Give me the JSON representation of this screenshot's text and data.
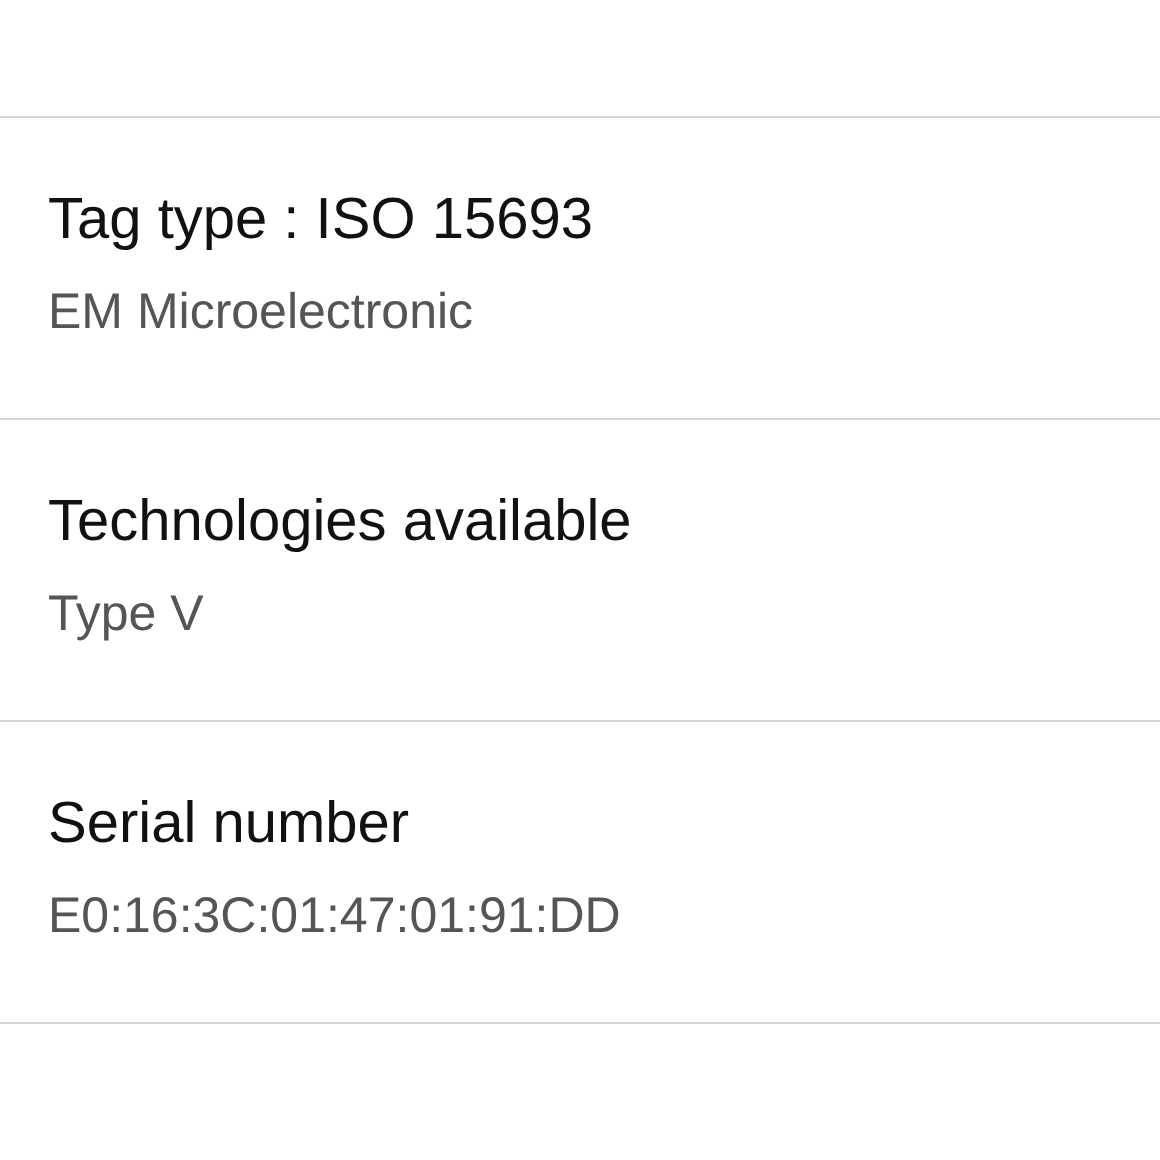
{
  "rows": [
    {
      "title": "Tag type : ISO 15693",
      "value": "EM Microelectronic"
    },
    {
      "title": "Technologies available",
      "value": "Type V"
    },
    {
      "title": "Serial number",
      "value": "E0:16:3C:01:47:01:91:DD"
    }
  ]
}
